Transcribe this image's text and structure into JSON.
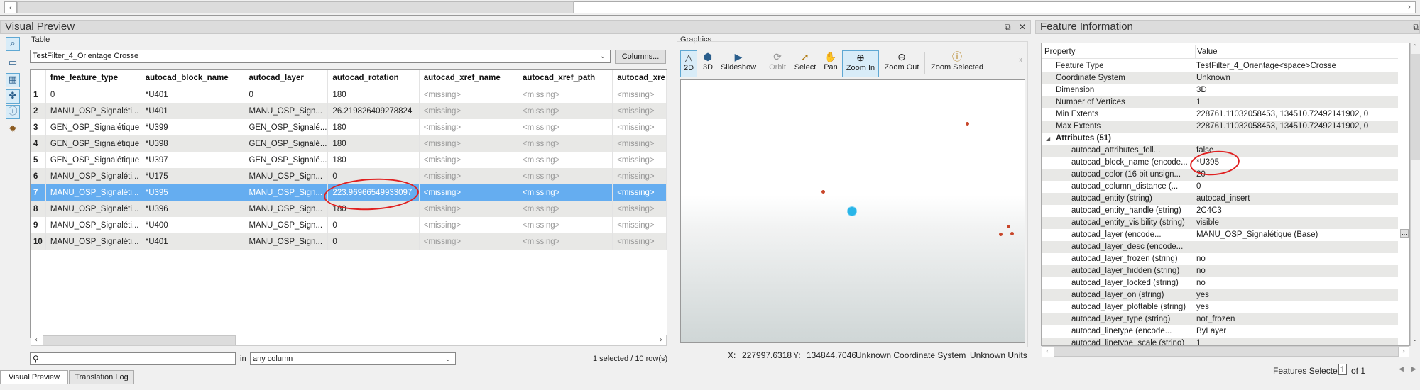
{
  "visual_preview": {
    "title": "Visual Preview",
    "restore_icon": "⧉",
    "close_icon": "✕",
    "side_toolbar": [
      {
        "name": "inspect-icon",
        "glyph": "⌕"
      },
      {
        "name": "layout-icon",
        "glyph": "▭"
      },
      {
        "name": "table-view-icon",
        "glyph": "▦"
      },
      {
        "name": "graphics-view-icon",
        "glyph": "✤"
      },
      {
        "name": "feature-info-icon",
        "glyph": "ⓘ"
      },
      {
        "name": "feature-inspect-icon",
        "glyph": "✹"
      }
    ],
    "table": {
      "group_label": "Table",
      "feature_type_selected": "TestFilter_4_Orientage Crosse",
      "columns_button": "Columns...",
      "headers": [
        "",
        "fme_feature_type",
        "autocad_block_name",
        "autocad_layer",
        "autocad_rotation",
        "autocad_xref_name",
        "autocad_xref_path",
        "autocad_xre"
      ],
      "rows": [
        [
          "1",
          "0",
          "*U401",
          "0",
          "180",
          "<missing>",
          "<missing>",
          "<missing>"
        ],
        [
          "2",
          "MANU_OSP_Signaléti...",
          "*U401",
          "MANU_OSP_Sign...",
          "26.219826409278824",
          "<missing>",
          "<missing>",
          "<missing>"
        ],
        [
          "3",
          "GEN_OSP_Signalétique",
          "*U399",
          "GEN_OSP_Signalé...",
          "180",
          "<missing>",
          "<missing>",
          "<missing>"
        ],
        [
          "4",
          "GEN_OSP_Signalétique",
          "*U398",
          "GEN_OSP_Signalé...",
          "180",
          "<missing>",
          "<missing>",
          "<missing>"
        ],
        [
          "5",
          "GEN_OSP_Signalétique",
          "*U397",
          "GEN_OSP_Signalé...",
          "180",
          "<missing>",
          "<missing>",
          "<missing>"
        ],
        [
          "6",
          "MANU_OSP_Signaléti...",
          "*U175",
          "MANU_OSP_Sign...",
          "0",
          "<missing>",
          "<missing>",
          "<missing>"
        ],
        [
          "7",
          "MANU_OSP_Signaléti...",
          "*U395",
          "MANU_OSP_Sign...",
          "223.96966549933097",
          "<missing>",
          "<missing>",
          "<missing>"
        ],
        [
          "8",
          "MANU_OSP_Signaléti...",
          "*U396",
          "MANU_OSP_Sign...",
          "180",
          "<missing>",
          "<missing>",
          "<missing>"
        ],
        [
          "9",
          "MANU_OSP_Signaléti...",
          "*U400",
          "MANU_OSP_Sign...",
          "0",
          "<missing>",
          "<missing>",
          "<missing>"
        ],
        [
          "10",
          "MANU_OSP_Signaléti...",
          "*U401",
          "MANU_OSP_Sign...",
          "0",
          "<missing>",
          "<missing>",
          "<missing>"
        ]
      ],
      "selected_row": 7,
      "search_placeholder": "",
      "search_in_label": "in",
      "search_column": "any column",
      "selection_status": "1 selected / 10 row(s)"
    },
    "graphics": {
      "group_label": "Graphics",
      "toolbar": [
        {
          "id": "2d",
          "label": "2D",
          "icon": "△",
          "active": true,
          "disabled": false
        },
        {
          "id": "3d",
          "label": "3D",
          "icon": "⬢",
          "active": false,
          "disabled": false
        },
        {
          "id": "slideshow",
          "label": "Slideshow",
          "icon": "▶",
          "active": false,
          "disabled": false
        },
        {
          "id": "orbit",
          "label": "Orbit",
          "icon": "⟳",
          "active": false,
          "disabled": true
        },
        {
          "id": "select",
          "label": "Select",
          "icon": "➚",
          "active": false,
          "disabled": false
        },
        {
          "id": "pan",
          "label": "Pan",
          "icon": "✋",
          "active": false,
          "disabled": false
        },
        {
          "id": "zoom-in",
          "label": "Zoom In",
          "icon": "⊕",
          "active": true,
          "disabled": false
        },
        {
          "id": "zoom-out",
          "label": "Zoom Out",
          "icon": "⊖",
          "active": false,
          "disabled": false
        },
        {
          "id": "zoom-selected",
          "label": "Zoom Selected",
          "icon": "ⓘ",
          "active": false,
          "disabled": false
        }
      ],
      "overflow_icon": "»",
      "status": {
        "x_label": "X:",
        "x_value": "227997.6318",
        "y_label": "Y:",
        "y_value": "134844.7046",
        "coord_system": "Unknown Coordinate System",
        "units": "Unknown Units"
      }
    },
    "tabs": [
      {
        "label": "Visual Preview",
        "active": true
      },
      {
        "label": "Translation Log",
        "active": false
      }
    ]
  },
  "feature_information": {
    "title": "Feature Information",
    "header": {
      "property": "Property",
      "value": "Value"
    },
    "properties": [
      {
        "key": "Feature Type",
        "value": "TestFilter_4_Orientage<space>Crosse"
      },
      {
        "key": "Coordinate System",
        "value": "Unknown"
      },
      {
        "key": "Dimension",
        "value": "3D"
      },
      {
        "key": "Number of Vertices",
        "value": "1"
      },
      {
        "key": "Min Extents",
        "value": "228761.11032058453, 134510.72492141902, 0"
      },
      {
        "key": "Max Extents",
        "value": "228761.11032058453, 134510.72492141902, 0"
      }
    ],
    "attributes_label": "Attributes (51)",
    "attributes": [
      {
        "key": "autocad_attributes_foll...",
        "value": "false"
      },
      {
        "key": "autocad_block_name (encode...",
        "value": "*U395"
      },
      {
        "key": "autocad_color (16 bit unsign...",
        "value": "20"
      },
      {
        "key": "autocad_column_distance (...",
        "value": "0"
      },
      {
        "key": "autocad_entity (string)",
        "value": "autocad_insert"
      },
      {
        "key": "autocad_entity_handle (string)",
        "value": "2C4C3"
      },
      {
        "key": "autocad_entity_visibility (string)",
        "value": "visible"
      },
      {
        "key": "autocad_layer (encode...",
        "value": "MANU_OSP_Signalétique (Base)"
      },
      {
        "key": "autocad_layer_desc (encode...",
        "value": ""
      },
      {
        "key": "autocad_layer_frozen (string)",
        "value": "no"
      },
      {
        "key": "autocad_layer_hidden (string)",
        "value": "no"
      },
      {
        "key": "autocad_layer_locked (string)",
        "value": "no"
      },
      {
        "key": "autocad_layer_on (string)",
        "value": "yes"
      },
      {
        "key": "autocad_layer_plottable (string)",
        "value": "yes"
      },
      {
        "key": "autocad_layer_type (string)",
        "value": "not_frozen"
      },
      {
        "key": "autocad_linetype (encode...",
        "value": "ByLayer"
      },
      {
        "key": "autocad_linetype_scale (string)",
        "value": "1"
      }
    ],
    "ellipsis_button": "...",
    "features_selected_label": "Features Selected:",
    "features_selected_value": "1",
    "features_selected_total": "of 1"
  }
}
